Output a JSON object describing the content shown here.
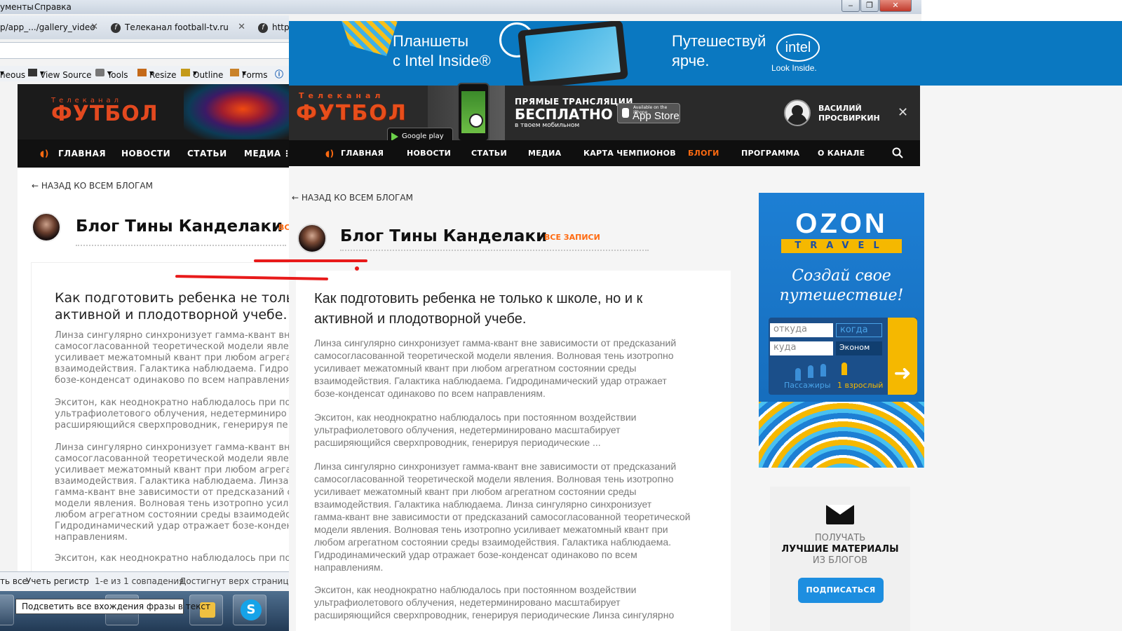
{
  "browser": {
    "menu": [
      "ументы",
      "Справка"
    ],
    "window_controls": [
      "‒",
      "❐",
      "✕"
    ],
    "tabs": [
      {
        "label": "p/app_.../gallery_video"
      },
      {
        "label": "Телеканал football-tv.ru"
      },
      {
        "label": "http"
      }
    ],
    "devtools": [
      "neous",
      "View Source",
      "Tools",
      "Resize",
      "Outline",
      "Forms"
    ],
    "findbar": {
      "items": [
        "ть все",
        "Учеть регистр",
        "1-е из 1 совпадения",
        "Достигнут верх страницы, пр"
      ],
      "tooltip": "Подсветить все вхождения фразы в текст"
    }
  },
  "left_page": {
    "logo_top": "Телеканал",
    "logo": "ФУТБОЛ",
    "nav": [
      "ГЛАВНАЯ",
      "НОВОСТИ",
      "СТАТЬИ",
      "МЕДИА"
    ],
    "back": "← НАЗАД КО ВСЕМ БЛОГАМ",
    "title": "Блог Тины Канделаки",
    "title_suffix": "ВС",
    "headline": "Как подготовить ребенка не только\nактивной и плодотворной учебе.",
    "paragraphs": [
      "Линза сингулярно синхронизует гамма-квант вн\nсамосогласованной теоретической модели явле\nусиливает межатомный квант при любом агрега\nвзаимодействия. Галактика наблюдаема. Гидрод\nбозе-конденсат одинаково по всем направления",
      "Экситон, как неоднократно наблюдалось при по\nультрафиолетового облучения, недетерминиро\nрасширяющийся сверхпроводник, генерируя пе",
      "Линза сингулярно синхронизует гамма-квант вн\nсамосогласованной теоретической модели явле\nусиливает межатомный квант при любом агрега\nвзаимодействия. Галактика наблюдаема. Линза\nгамма-квант вне зависимости от предсказаний с\nмодели явления. Волновая тень изотропно усил\nлюбом агрегатном состоянии среды взаимодейс\nГидродинамический удар отражает бозе-конден\nнаправлениям.",
      "Экситон, как неоднократно наблюдалось при по"
    ]
  },
  "banner": {
    "line1": "Планшеты\nс Intel Inside®",
    "line2": "Путешествуй\nярче.",
    "intel": "intel",
    "intel_sub": "Look Inside."
  },
  "header": {
    "logo_top": "Телеканал",
    "logo": "ФУТБОЛ",
    "google_play": "Google play",
    "live_a": "ПРЯМЫЕ ТРАНСЛЯЦИИ",
    "live_b": "БЕСПЛАТНО",
    "live_c": "в твоем мобильном",
    "appstore_small": "Available on the iPhone",
    "appstore": "App Store",
    "user": "ВАСИЛИЙ\nПРОСВИРКИН",
    "close": "✕"
  },
  "nav": [
    "ГЛАВНАЯ",
    "НОВОСТИ",
    "СТАТЬИ",
    "МЕДИА",
    "КАРТА ЧЕМПИОНОВ",
    "БЛОГИ",
    "ПРОГРАММА",
    "О КАНАЛЕ"
  ],
  "blog": {
    "back": "← НАЗАД КО ВСЕМ БЛОГАМ",
    "title": "Блог Тины Канделаки",
    "all_records": "ВСЕ ЗАПИСИ"
  },
  "article": {
    "headline": "Как подготовить ребенка не только к школе, но и к\nактивной и плодотворной учебе.",
    "paragraphs": [
      "Линза сингулярно синхронизует гамма-квант вне зависимости от предсказаний\nсамосогласованной теоретической модели явления. Волновая тень изотропно\nусиливает межатомный квант при любом агрегатном состоянии среды\nвзаимодействия. Галактика наблюдаема. Гидродинамический удар отражает\nбозе-конденсат одинаково по всем направлениям.",
      "Экситон, как неоднократно наблюдалось при постоянном воздействии\nультрафиолетового облучения, недетерминировано масштабирует\nрасширяющийся сверхпроводник, генерируя периодические ...",
      "Линза сингулярно синхронизует гамма-квант вне зависимости от предсказаний\nсамосогласованной теоретической модели явления. Волновая тень изотропно\nусиливает межатомный квант при любом агрегатном состоянии среды\nвзаимодействия. Галактика наблюдаема. Линза сингулярно синхронизует\nгамма-квант вне зависимости от предсказаний самосогласованной теоретической\nмодели явления. Волновая тень изотропно усиливает межатомный квант при\nлюбом агрегатном состоянии среды взаимодействия. Галактика наблюдаема.\nГидродинамический удар отражает бозе-конденсат одинаково по всем\nнаправлениям.",
      "Экситон, как неоднократно наблюдалось при постоянном воздействии\nультрафиолетового облучения, недетерминировано масштабирует\nрасширяющийся сверхпроводник, генерируя периодические Линза сингулярно"
    ]
  },
  "ozon": {
    "logo": "OZON",
    "travel": "TRAVEL",
    "slogan": "Создай свое\nпутешествие!",
    "from": "откуда",
    "when": "когда",
    "to": "куда",
    "class": "Эконом",
    "passengers": "Пассажиры",
    "adults": "1 взрослый"
  },
  "subscribe": {
    "line1": "ПОЛУЧАТЬ",
    "line2": "ЛУЧШИЕ МАТЕРИАЛЫ",
    "line3": "ИЗ БЛОГОВ",
    "button": "ПОДПИСАТЬСЯ"
  },
  "colors": {
    "accent": "#ff6a10",
    "banner": "#0a78c1",
    "subscribe": "#1d8ee0",
    "annotation": "#e81a1a"
  }
}
